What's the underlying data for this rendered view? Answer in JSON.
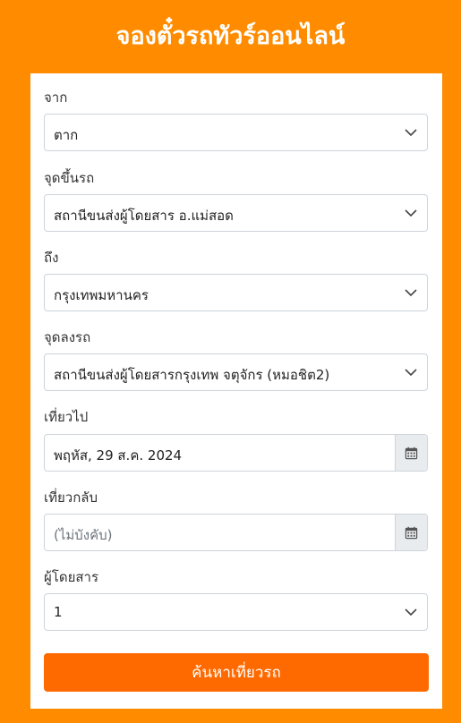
{
  "header": {
    "title": "จองตั๋วรถทัวร์ออนไลน์"
  },
  "form": {
    "from": {
      "label": "จาก",
      "value": "ตาก"
    },
    "pickup": {
      "label": "จุดขึ้นรถ",
      "value": "สถานีขนส่งผู้โดยสาร อ.แม่สอด"
    },
    "to": {
      "label": "ถึง",
      "value": "กรุงเทพมหานคร"
    },
    "dropoff": {
      "label": "จุดลงรถ",
      "value": "สถานีขนส่งผู้โดยสารกรุงเทพ จตุจักร (หมอชิต2)"
    },
    "depart": {
      "label": "เที่ยวไป",
      "value": "พฤหัส, 29 ส.ค. 2024"
    },
    "return": {
      "label": "เที่ยวกลับ",
      "placeholder": "(ไม่บังคับ)"
    },
    "passengers": {
      "label": "ผู้โดยสาร",
      "value": "1"
    },
    "submit_label": "ค้นหาเที่ยวรถ"
  },
  "colors": {
    "background": "#FF8C00",
    "button": "#FF6A00"
  }
}
